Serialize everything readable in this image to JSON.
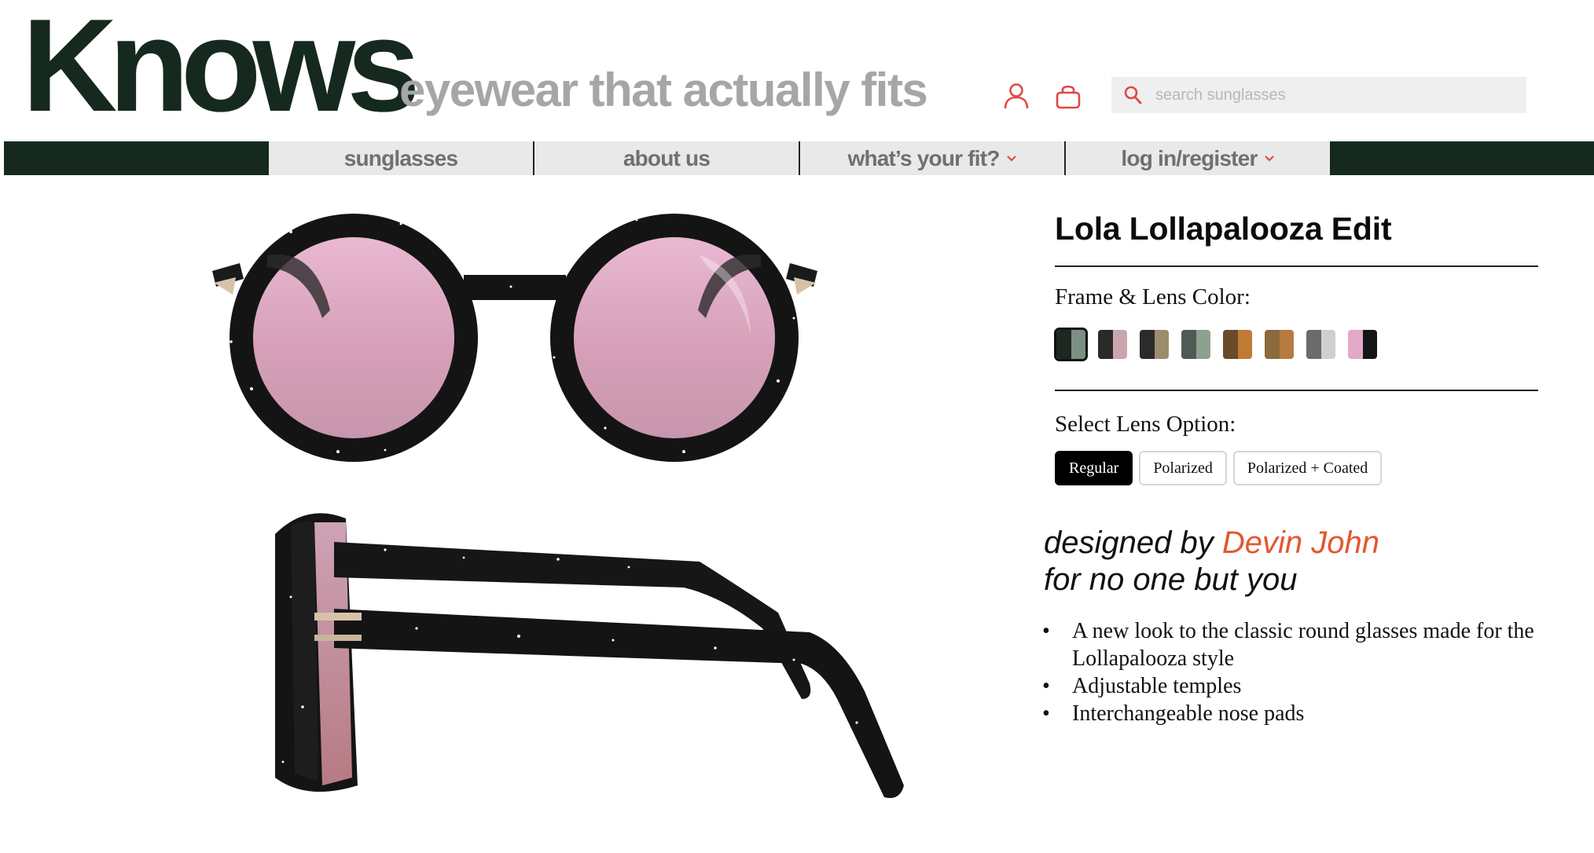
{
  "brand": {
    "logo": "Knows",
    "tagline": "eyewear that actually fits"
  },
  "header": {
    "account_icon": "user-icon",
    "bag_icon": "shopping-bag-icon",
    "search": {
      "icon": "search-icon",
      "placeholder": "search sunglasses",
      "value": ""
    }
  },
  "nav": {
    "items": [
      {
        "label": "sunglasses",
        "dropdown": false
      },
      {
        "label": "about us",
        "dropdown": false
      },
      {
        "label": "what’s your fit?",
        "dropdown": true
      },
      {
        "label": "log in/register",
        "dropdown": true
      }
    ]
  },
  "product": {
    "title": "Lola Lollapalooza Edit",
    "images": {
      "front": "sunglasses-front-view",
      "side": "sunglasses-side-view"
    },
    "color_label": "Frame & Lens Color:",
    "swatches": [
      {
        "colors": [
          "#1f2622",
          "#7b8f82"
        ],
        "selected": true
      },
      {
        "colors": [
          "#2a2a2a",
          "#c9a6ad"
        ],
        "selected": false
      },
      {
        "colors": [
          "#2b2b2b",
          "#9b8c6b"
        ],
        "selected": false
      },
      {
        "colors": [
          "#505a54",
          "#8ea08f"
        ],
        "selected": false
      },
      {
        "colors": [
          "#6b4a2a",
          "#c07a36"
        ],
        "selected": false
      },
      {
        "colors": [
          "#8c6a3d",
          "#b77b3f"
        ],
        "selected": false
      },
      {
        "colors": [
          "#6b6b6b",
          "#cfcfcf"
        ],
        "selected": false
      },
      {
        "colors": [
          "#e2a9c8",
          "#151515"
        ],
        "selected": false
      }
    ],
    "lens_label": "Select Lens Option:",
    "lens_options": [
      {
        "label": "Regular",
        "active": true
      },
      {
        "label": "Polarized",
        "active": false
      },
      {
        "label": "Polarized + Coated",
        "active": false
      }
    ],
    "designed_prefix": "designed by ",
    "designer": "Devin John",
    "designed_line2": "for no one but you",
    "features": [
      "A new look to the classic round glasses made for the Lollapalooza style",
      "Adjustable temples",
      "Interchangeable nose pads"
    ]
  },
  "colors": {
    "brand_dark": "#16291f",
    "accent": "#e4572e",
    "icon_red": "#e04848"
  }
}
